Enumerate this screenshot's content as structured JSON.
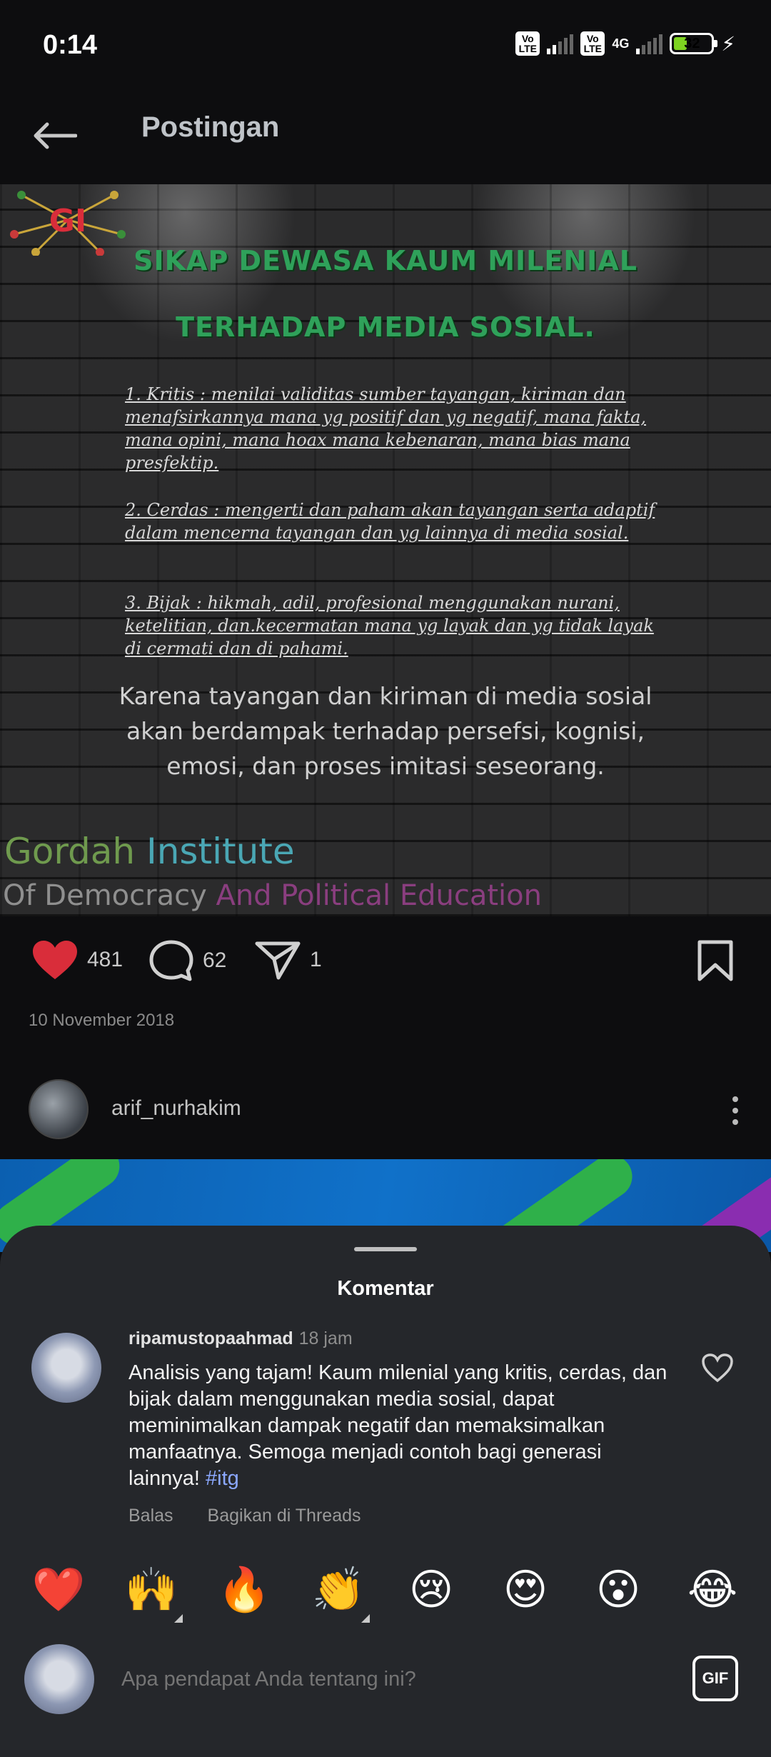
{
  "status_bar": {
    "time": "0:14",
    "volte1": "Vo LTE",
    "volte2": "Vo LTE",
    "network": "4G",
    "battery": "32",
    "battery_level": 0.32
  },
  "header": {
    "title": "Postingan"
  },
  "post_image": {
    "title_line1": "SIKAP DEWASA KAUM MILENIAL",
    "title_line2": "TERHADAP MEDIA SOSIAL.",
    "item1": "1. Kritis : menilai  validitas sumber tayangan, kiriman dan menafsirkannya mana yg positif dan yg negatif, mana fakta, mana opini, mana hoax mana kebenaran, mana bias mana presfektip.",
    "item2": "2. Cerdas : mengerti dan paham akan tayangan serta adaptif dalam mencerna tayangan dan yg lainnya di media sosial.",
    "item3": "3. Bijak : hikmah, adil, profesional menggunakan nurani, ketelitian, dan.kecermatan mana yg layak dan yg tidak layak di cermati dan di pahami.",
    "quote": "Karena tayangan dan kiriman di media sosial akan berdampak terhadap persefsi, kognisi, emosi, dan proses imitasi seseorang.",
    "brand_word1": "Gordah",
    "brand_word2": "Institute",
    "brand_line2_a": "Of Democracy ",
    "brand_line2_b": "And Political Education",
    "logo_text": "GI"
  },
  "actions": {
    "likes": "481",
    "comments": "62",
    "shares": "1",
    "date": "10 November 2018"
  },
  "author": {
    "username": "arif_nurhakim"
  },
  "comments_sheet": {
    "title": "Komentar",
    "comment": {
      "username": "ripamustopaahmad",
      "time": "18 jam",
      "text": "Analisis yang tajam!  Kaum milenial yang kritis, cerdas, dan bijak dalam menggunakan media sosial, dapat meminimalkan dampak negatif dan memaksimalkan manfaatnya. Semoga menjadi contoh bagi generasi lainnya! ",
      "hashtag": "#itg",
      "reply": "Balas",
      "share_threads": "Bagikan di Threads"
    },
    "emojis": [
      "❤️",
      "🙌",
      "🔥",
      "👏",
      "😢",
      "😍",
      "😮",
      "😂"
    ],
    "input_placeholder": "Apa pendapat Anda tentang ini?",
    "gif_label": "GIF"
  },
  "colors": {
    "like_red": "#d92d3a",
    "hashtag": "#8ba8ff",
    "title_green": "#2fa15a"
  }
}
